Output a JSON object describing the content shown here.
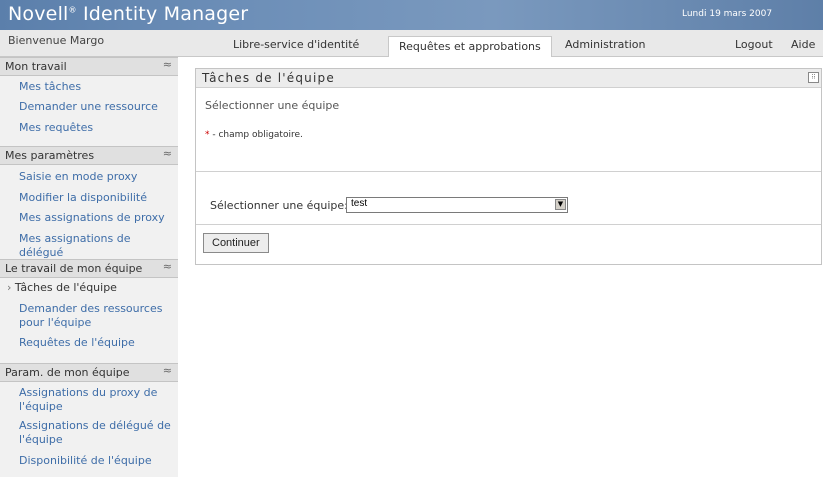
{
  "header": {
    "brand": "Novell",
    "brand_mark": "®",
    "product": " Identity Manager",
    "date": "Lundi 19 mars 2007"
  },
  "navbar": {
    "welcome": "Bienvenue Margo",
    "tabs": [
      {
        "label": "Libre-service d'identité",
        "active": false
      },
      {
        "label": "Requêtes et approbations",
        "active": true
      },
      {
        "label": "Administration",
        "active": false
      }
    ],
    "logout": "Logout",
    "help": "Aide"
  },
  "sidebar": {
    "sections": [
      {
        "title": "Mon travail",
        "items": [
          "Mes tâches",
          "Demander une ressource",
          "Mes requêtes"
        ]
      },
      {
        "title": "Mes paramètres",
        "items": [
          "Saisie en mode proxy",
          "Modifier la disponibilité",
          "Mes assignations de proxy",
          "Mes assignations de délégué"
        ]
      },
      {
        "title": "Le travail de mon équipe",
        "items": [
          "Tâches de l'équipe",
          "Demander des ressources pour l'équipe",
          "Requêtes de l'équipe"
        ],
        "current_index": 0
      },
      {
        "title": "Param. de mon équipe",
        "items": [
          "Assignations du proxy de l'équipe",
          "Assignations de délégué de l'équipe",
          "Disponibilité de l'équipe"
        ]
      }
    ],
    "collapse_glyph": "≈"
  },
  "panel": {
    "title": "Tâches de l'équipe",
    "subtitle": "Sélectionner une équipe",
    "required_star": "*",
    "required_note": " - champ obligatoire.",
    "field_label": "Sélectionner une équipe:",
    "field_star": "*",
    "select_value": "test",
    "button": "Continuer"
  },
  "colors": {
    "header_blue": "#6d8fb8",
    "link_blue": "#3e6da8",
    "required_red": "#cc0000"
  },
  "icons": [
    "collapse-icon",
    "panel-menu-icon",
    "dropdown-arrow-icon",
    "bullet-icon"
  ]
}
